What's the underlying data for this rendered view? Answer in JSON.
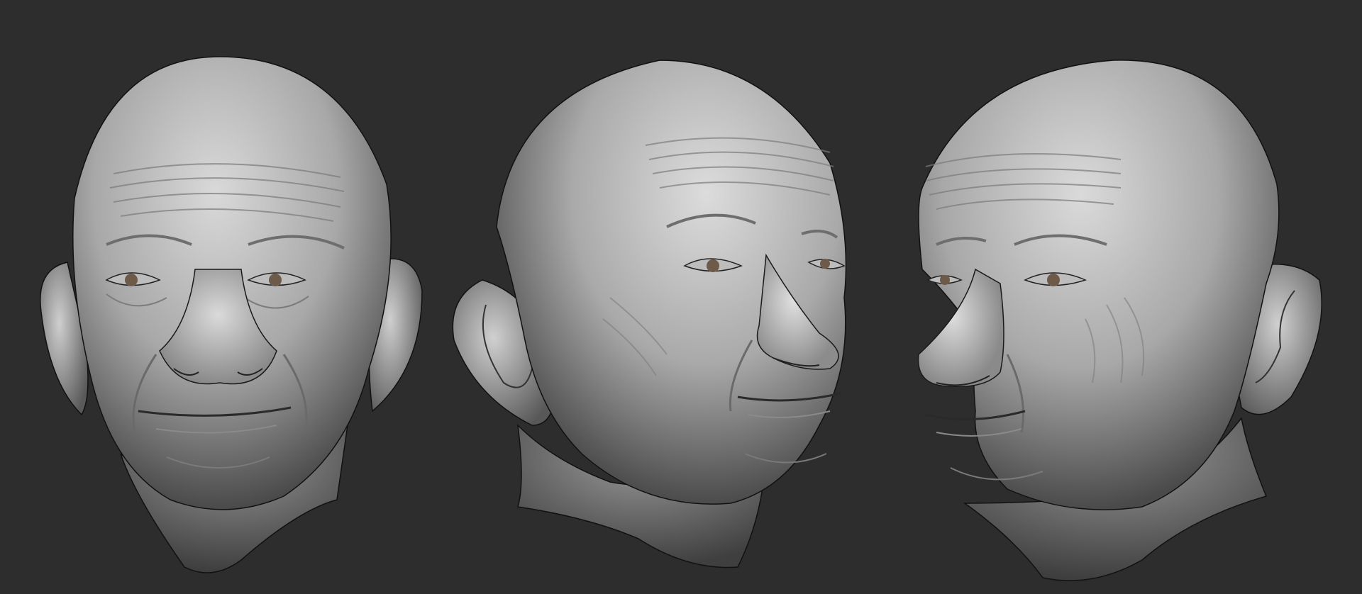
{
  "scene": {
    "background_color": "#2d2d2e",
    "skin_color": "#a9a9a9",
    "skin_light": "#d4d4d4",
    "skin_shadow": "#555555",
    "iris_color": "#6e5a48",
    "outline_color": "#111111"
  },
  "views": [
    {
      "name": "front",
      "angle": "front"
    },
    {
      "name": "three-quarter",
      "angle": "three-quarter-right"
    },
    {
      "name": "profile",
      "angle": "three-quarter-left"
    }
  ]
}
